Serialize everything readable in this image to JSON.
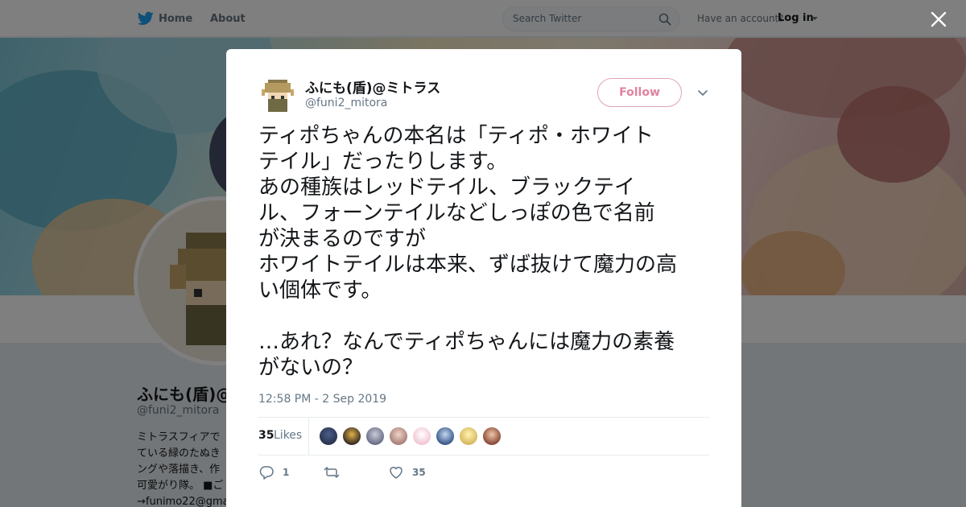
{
  "header": {
    "nav_home": "Home",
    "nav_about": "About",
    "search_placeholder": "Search Twitter",
    "have_account": "Have an account?",
    "login": "Log in"
  },
  "profile": {
    "name": "ふにも(盾)@",
    "handle": "@funi2_mitora",
    "bio": "ミトラスフィアで\nている緑のたぬき\nングや落描き、作\n可愛がり隊。 ■ご\n→funimo22@gma"
  },
  "tweet": {
    "author_name": "ふにも(盾)@ミトラス",
    "author_handle": "@funi2_mitora",
    "follow_label": "Follow",
    "text": "ティポちゃんの本名は「ティポ・ホワイト\nテイル」だったりします。\nあの種族はレッドテイル、ブラックテイ\nル、フォーンテイルなどしっぽの色で名前\nが決まるのですが\nホワイトテイルは本来、ずば抜けて魔力の高\nい個体です。\n\n…あれ？なんでティポちゃんには魔力の素養\nがないの？",
    "timestamp": "12:58 PM - 2 Sep 2019",
    "likes_count": "35",
    "likes_label": "Likes",
    "reply_count": "1",
    "retweet_count": "",
    "like_count": "35"
  },
  "colors": {
    "accent": "#1da1f2",
    "follow_pink": "#e2819e",
    "text_primary": "#14171a",
    "text_secondary": "#657786"
  },
  "icons": [
    "twitter-bird-icon",
    "search-icon",
    "caret-down-icon",
    "close-icon",
    "chevron-down-icon",
    "reply-icon",
    "retweet-icon",
    "heart-icon"
  ]
}
